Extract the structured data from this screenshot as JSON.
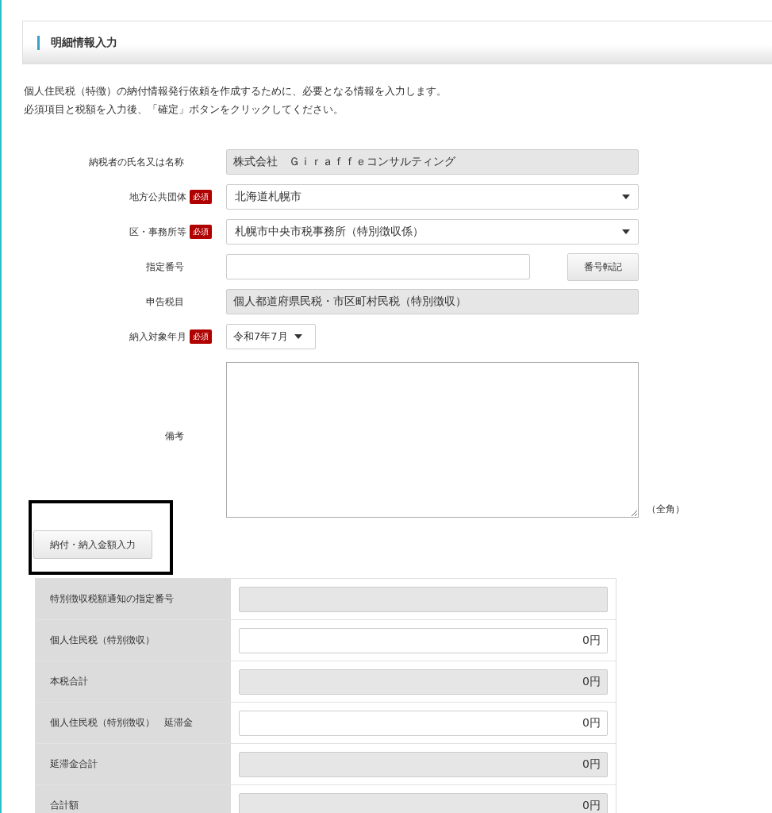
{
  "section": {
    "title": "明細情報入力"
  },
  "description": [
    "個人住民税（特徴）の納付情報発行依頼を作成するために、必要となる情報を入力します。",
    "必須項目と税額を入力後、「確定」ボタンをクリックしてください。"
  ],
  "form": [
    {
      "label": "納税者の氏名又は名称",
      "kind": "readonly",
      "value": "株式会社　Ｇｉｒａｆｆｅコンサルティング"
    },
    {
      "label": "地方公共団体",
      "badge": "必須",
      "kind": "select",
      "value": "北海道札幌市"
    },
    {
      "label": "区・事務所等",
      "badge": "必須",
      "kind": "select",
      "value": "札幌市中央市税事務所（特別徴収係）"
    },
    {
      "label": "指定番号",
      "kind": "text_button",
      "button": "番号転記"
    },
    {
      "label": "申告税目",
      "kind": "readonly",
      "value": "個人都道府県民税・市区町村民税（特別徴収）"
    },
    {
      "label": "納入対象年月",
      "badge": "必須",
      "kind": "small_select",
      "value": "令和7年7月"
    },
    {
      "label": "備考",
      "kind": "textarea",
      "note": "（全角）"
    }
  ],
  "amount_button": {
    "label": "納付・納入金額入力",
    "highlighted": true
  },
  "amounts": [
    {
      "label": "特別徴収税額通知の指定番号",
      "editable": false
    },
    {
      "label": "個人住民税（特別徴収）",
      "editable": true,
      "value": "0円"
    },
    {
      "label": "本税合計",
      "editable": false,
      "value": "0円"
    },
    {
      "label": "個人住民税（特別徴収）　延滞金",
      "editable": true,
      "value": "0円"
    },
    {
      "label": "延滞金合計",
      "editable": false,
      "value": "0円"
    },
    {
      "label": "合計額",
      "editable": false,
      "value": "0円"
    }
  ]
}
